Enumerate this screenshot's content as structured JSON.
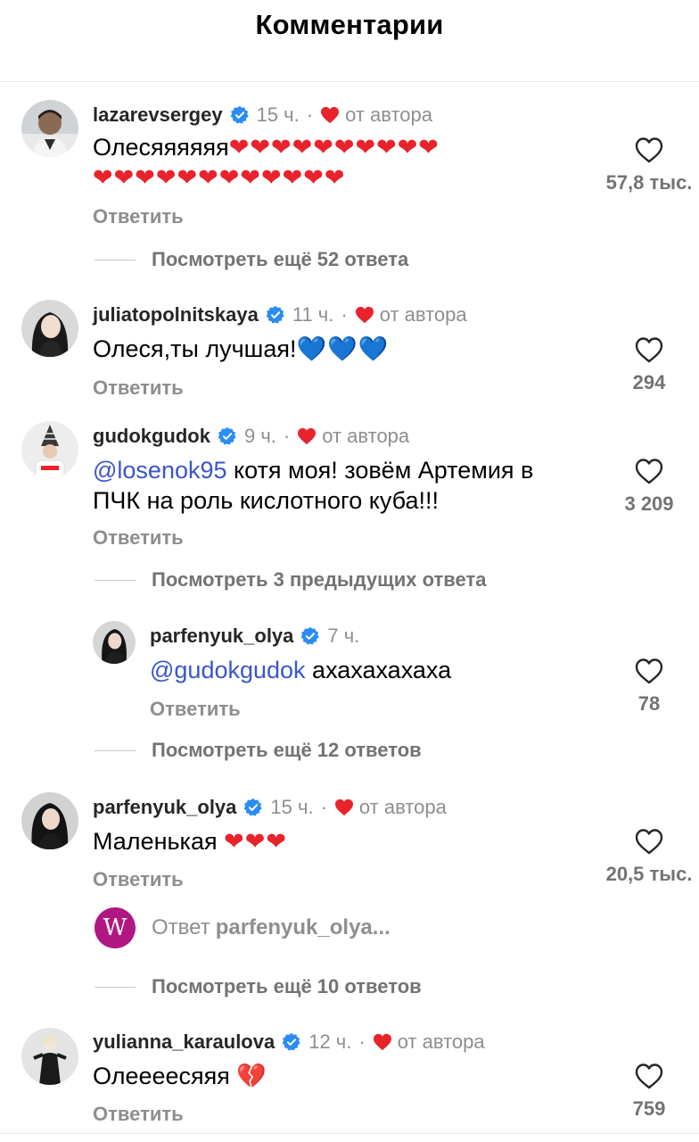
{
  "header": {
    "title": "Комментарии"
  },
  "comments": [
    {
      "username": "lazarevsergey",
      "time": "15 ч.",
      "dot": "·",
      "author_like": "от автора",
      "text_line1": "Олесяяяяяя",
      "hearts_line1": "❤❤❤❤❤❤❤❤❤❤",
      "hearts_line2": "❤❤❤❤❤❤❤❤❤❤❤❤",
      "reply_label": "Ответить",
      "likes": "57,8 тыс.",
      "more_replies": "Посмотреть ещё 52 ответа"
    },
    {
      "username": "juliatopolnitskaya",
      "time": "11 ч.",
      "dot": "·",
      "author_like": "от автора",
      "text": "Олеся,ты лучшая!",
      "emoji": "💙💙💙",
      "reply_label": "Ответить",
      "likes": "294"
    },
    {
      "username": "gudokgudok",
      "time": "9 ч.",
      "dot": "·",
      "author_like": "от автора",
      "mention": "@losenok95",
      "text_line1": " котя моя! зовём Артемия в",
      "text_line2": "ПЧК на роль кислотного куба!!!",
      "reply_label": "Ответить",
      "likes": "3 209",
      "more_replies": "Посмотреть 3 предыдущих ответа",
      "reply": {
        "username": "parfenyuk_olya",
        "time": "7 ч.",
        "mention": "@gudokgudok",
        "text": " ахахахахаха",
        "reply_label": "Ответить",
        "likes": "78"
      },
      "more_replies_after": "Посмотреть ещё 12 ответов"
    },
    {
      "username": "parfenyuk_olya",
      "time": "15 ч.",
      "dot": "·",
      "author_like": "от автора",
      "text": "Маленькая ",
      "emoji": "❤❤❤",
      "reply_label": "Ответить",
      "likes": "20,5 тыс.",
      "reply_preview": {
        "badge": "W",
        "prefix": "Ответ",
        "user": "parfenyuk_olya..."
      },
      "more_replies": "Посмотреть ещё 10 ответов"
    },
    {
      "username": "yulianna_karaulova",
      "time": "12 ч.",
      "dot": "·",
      "author_like": "от автора",
      "text": "Олеееесяяя ",
      "emoji": "💔",
      "reply_label": "Ответить",
      "likes": "759"
    }
  ],
  "icons": {
    "like": "heart-outline-icon",
    "verified": "verified-badge-icon",
    "author_like": "red-heart-icon"
  },
  "colors": {
    "heart": "#e8232c",
    "verified": "#2a8cf5",
    "mention": "#3a55c9",
    "muted": "#8e8e8e"
  }
}
